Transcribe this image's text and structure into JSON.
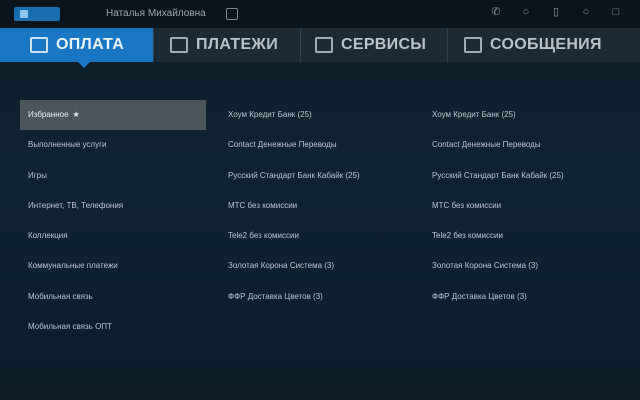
{
  "statusbar": {
    "user_name": "Наталья Михайловна",
    "icons": [
      "phone-icon",
      "info-icon",
      "battery-icon",
      "mail-icon",
      "exit-app-icon"
    ]
  },
  "tabs": [
    {
      "label": "ОПЛАТА",
      "active": true,
      "icon": "wallet-icon"
    },
    {
      "label": "ПЛАТЕЖИ",
      "active": false,
      "icon": "payments-icon"
    },
    {
      "label": "СЕРВИСЫ",
      "active": false,
      "icon": "services-icon"
    },
    {
      "label": "СООБЩЕНИЯ",
      "active": false,
      "icon": "messages-icon"
    }
  ],
  "categories": [
    {
      "label": "Избранное",
      "selected": true
    },
    {
      "label": "Выполненные услуги",
      "selected": false
    },
    {
      "label": "Игры",
      "selected": false
    },
    {
      "label": "Интернет, ТВ, Телефония",
      "selected": false
    },
    {
      "label": "Коллекция",
      "selected": false
    },
    {
      "label": "Коммунальные платежи",
      "selected": false
    },
    {
      "label": "Мобильная связь",
      "selected": false
    },
    {
      "label": "Мобильная связь ОПТ",
      "selected": false
    }
  ],
  "providers_col2": [
    "Хоум Кредит Банк (25)",
    "Contact Денежные Переводы",
    "Русский Стандарт Банк Кабайк (25)",
    "МТС без комиссии",
    "Tele2 без комиссии",
    "Золотая Корона Система (3)",
    "ФФР Доставка Цветов (3)"
  ],
  "providers_col3": [
    "Хоум Кредит Банк (25)",
    "Contact Денежные Переводы",
    "Русский Стандарт Банк Кабайк (25)",
    "МТС без комиссии",
    "Tele2 без комиссии",
    "Золотая Корона Система (3)",
    "ФФР Доставка Цветов (3)"
  ],
  "colors": {
    "accent": "#1976c3",
    "selected_bg": "#4b555c",
    "tabbar": "#1d2a34"
  }
}
